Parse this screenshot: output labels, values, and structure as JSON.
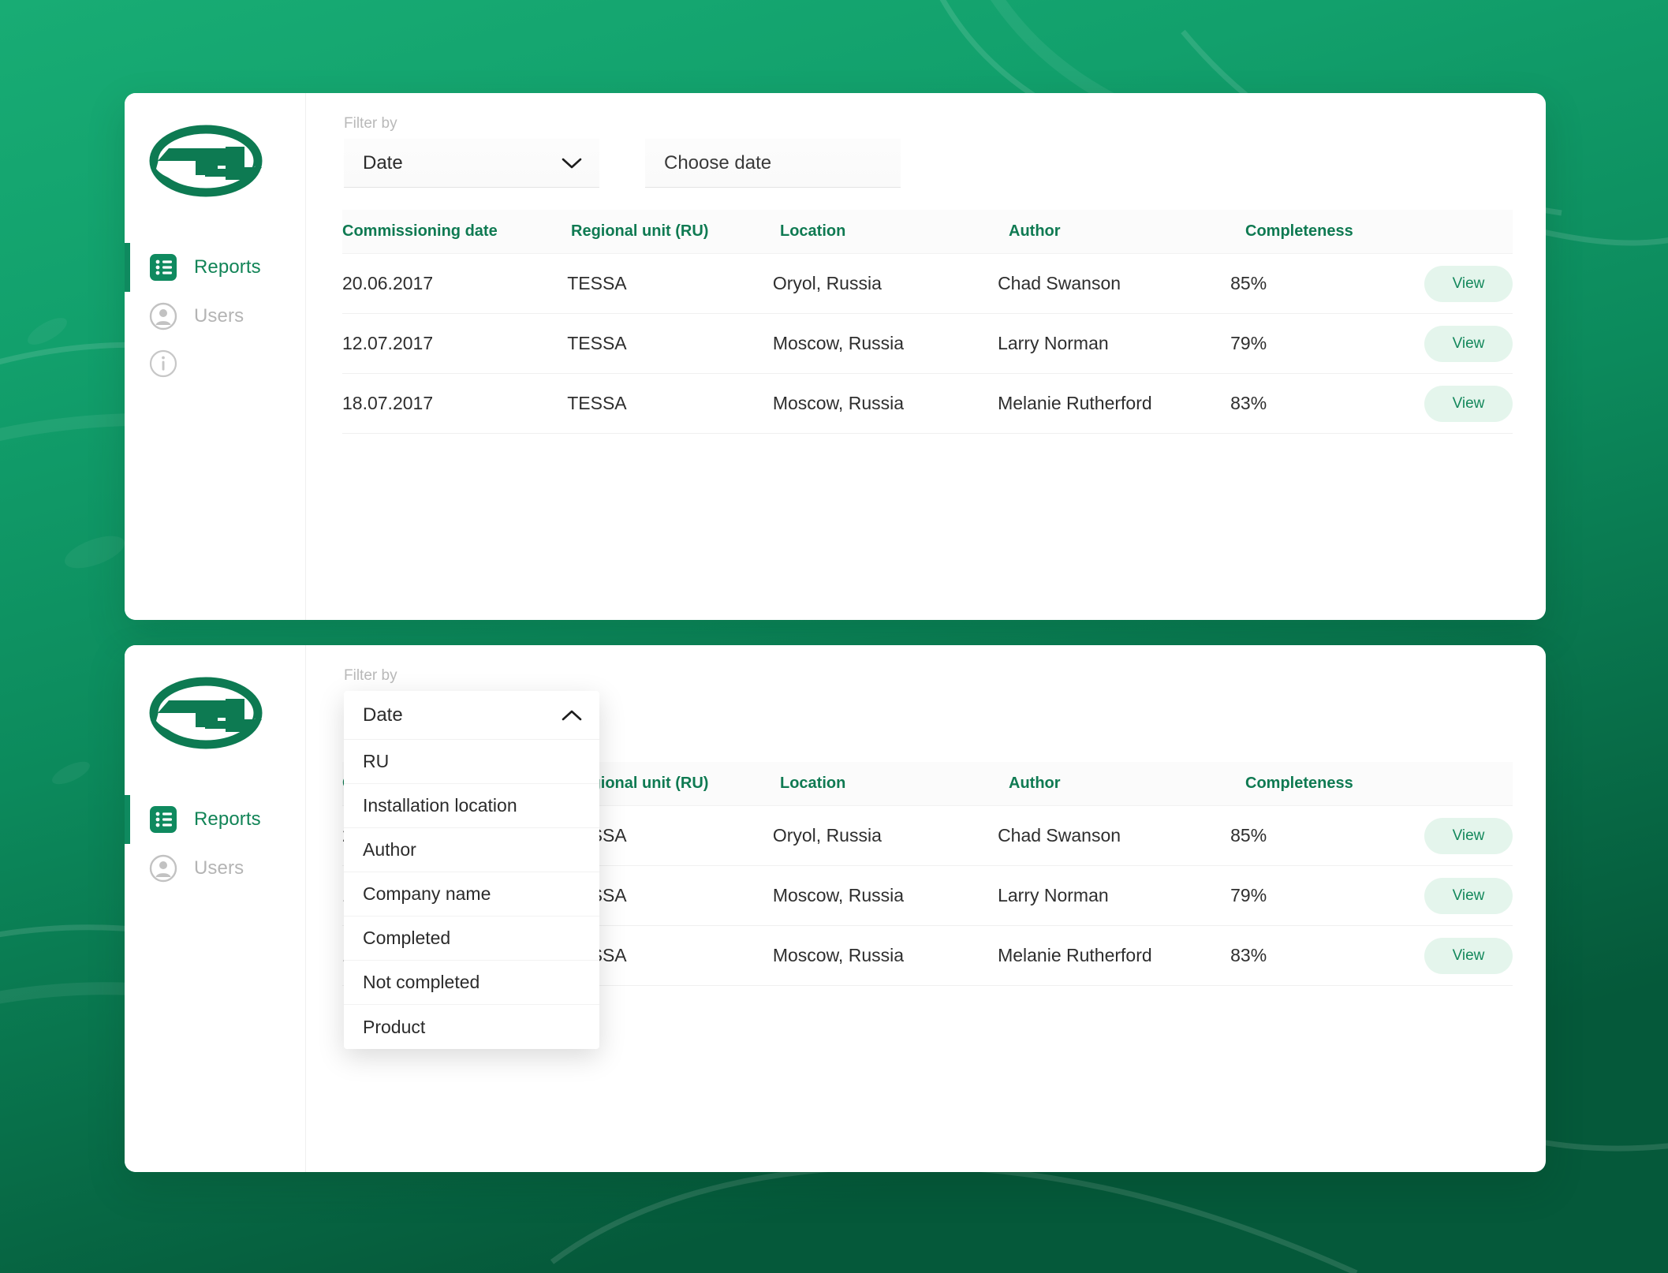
{
  "theme": {
    "background_green": "#12a06c",
    "background_green_dark": "#06603f",
    "brand_green": "#0f8a5f",
    "accent_text_green": "#128457",
    "header_text_green": "#0f7a52",
    "pill_bg": "#e4f5ec",
    "pill_text": "#14885c",
    "muted_gray": "#b4b4b4"
  },
  "sidebar": {
    "logo_name": "tel-logo",
    "items": [
      {
        "label": "Reports",
        "icon": "list-icon",
        "state": "active"
      },
      {
        "label": "Users",
        "icon": "user-circle-icon",
        "state": "inactive"
      },
      {
        "label": "",
        "icon": "info-circle-icon",
        "state": "inactive"
      }
    ]
  },
  "filters": {
    "label": "Filter by",
    "select": {
      "value": "Date",
      "icon_collapsed": "chevron-down-icon",
      "icon_expanded": "chevron-up-icon"
    },
    "date_field": {
      "placeholder": "Choose date",
      "value": ""
    },
    "options": [
      "Date",
      "RU",
      "Installation location",
      "Author",
      "Company name",
      "Completed",
      "Not completed",
      "Product"
    ]
  },
  "table": {
    "columns": [
      "Commissioning date",
      "Regional unit (RU)",
      "Location",
      "Author",
      "Completeness"
    ],
    "action_label": "View",
    "rows": [
      {
        "date": "20.06.2017",
        "ru": "TESSA",
        "location": "Oryol, Russia",
        "author": "Chad Swanson",
        "completeness": "85%"
      },
      {
        "date": "12.07.2017",
        "ru": "TESSA",
        "location": "Moscow, Russia",
        "author": "Larry Norman",
        "completeness": "79%"
      },
      {
        "date": "18.07.2017",
        "ru": "TESSA",
        "location": "Moscow, Russia",
        "author": "Melanie Rutherford",
        "completeness": "83%"
      }
    ]
  }
}
